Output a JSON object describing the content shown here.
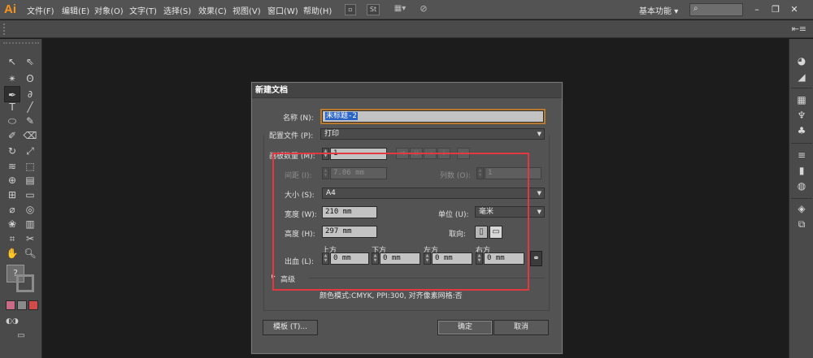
{
  "app": {
    "logo": "Ai",
    "menu": [
      "文件(F)",
      "编辑(E)",
      "对象(O)",
      "文字(T)",
      "选择(S)",
      "效果(C)",
      "视图(V)",
      "窗口(W)",
      "帮助(H)"
    ],
    "toolbar_icons": [
      "bridge-icon",
      "stock-icon",
      "arrange-documents-icon",
      "gpu-performance-icon"
    ],
    "stock_icon_text": "St",
    "workspace": "基本功能",
    "window_controls": [
      "minimize-icon",
      "restore-icon",
      "close-icon"
    ]
  },
  "tools": [
    "selection",
    "direct-selection",
    "magic-wand",
    "lasso",
    "pen",
    "curvature",
    "type",
    "line-segment",
    "ellipse",
    "paintbrush",
    "shaper",
    "eraser",
    "rotate",
    "scale",
    "warp",
    "free-transform",
    "shape-builder",
    "chart",
    "mesh",
    "gradient",
    "eyedropper",
    "blend",
    "symbol-sprayer",
    "column-graph",
    "artboard",
    "slice",
    "hand",
    "zoom"
  ],
  "dock_icons": [
    "color-icon",
    "color-guide-icon",
    "swatches-icon",
    "brushes-icon",
    "symbols-icon",
    "stroke-icon",
    "gradient-icon",
    "transparency-icon",
    "appearance-icon",
    "graphic-styles-icon",
    "layers-icon",
    "artboards-icon"
  ],
  "dialog": {
    "title": "新建文档",
    "name_label": "名称 (N):",
    "name_value": "未标题-2",
    "profile_label": "配置文件 (P):",
    "profile_value": "打印",
    "artboards_label": "画板数量 (M):",
    "artboards_value": "1",
    "spacing_label": "间距 (I):",
    "spacing_value": "7.06 mm",
    "columns_label": "列数 (O):",
    "columns_value": "1",
    "size_label": "大小 (S):",
    "size_value": "A4",
    "width_label": "宽度 (W):",
    "width_value": "210 mm",
    "units_label": "单位 (U):",
    "units_value": "毫米",
    "height_label": "高度 (H):",
    "height_value": "297 mm",
    "orientation_label": "取向:",
    "bleed_label": "出血 (L):",
    "bleed": {
      "top_label": "上方",
      "top_value": "0 mm",
      "bottom_label": "下方",
      "bottom_value": "0 mm",
      "left_label": "左方",
      "left_value": "0 mm",
      "right_label": "右方",
      "right_value": "0 mm"
    },
    "advanced_label": "高级",
    "info": "颜色模式:CMYK, PPI:300, 对齐像素网格:否",
    "templates_button": "模板 (T)...",
    "ok_button": "确定",
    "cancel_button": "取消"
  },
  "colors": {
    "accent_orange": "#f7941d",
    "annotation_red": "#e2383f",
    "selection_blue": "#2b63c7"
  }
}
